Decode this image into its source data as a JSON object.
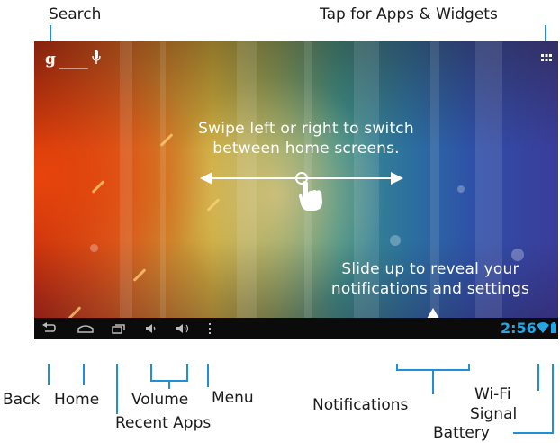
{
  "callouts": {
    "search": "Search",
    "apps_widgets": "Tap for Apps & Widgets",
    "back": "Back",
    "home": "Home",
    "recent_apps": "Recent Apps",
    "volume": "Volume",
    "menu": "Menu",
    "notifications": "Notifications",
    "wifi_signal_line1": "Wi-Fi",
    "wifi_signal_line2": "Signal",
    "battery": "Battery"
  },
  "screen": {
    "swipe_hint_line1": "Swipe left or right to switch",
    "swipe_hint_line2": "between home screens.",
    "slide_hint_line1": "Slide up to reveal your",
    "slide_hint_line2": "notifications and settings",
    "search_glyph": "g",
    "clock": "2:56"
  },
  "icons": {
    "search": "google-g-icon",
    "voice": "microphone-icon",
    "apps": "apps-grid-icon",
    "back": "back-icon",
    "home": "home-icon",
    "recent": "recent-apps-icon",
    "volume_down": "volume-down-icon",
    "volume_up": "volume-up-icon",
    "menu": "menu-icon",
    "wifi": "wifi-icon",
    "battery": "battery-icon",
    "swipe_hand": "swipe-hand-icon"
  },
  "colors": {
    "callout_line": "#1f8fd6",
    "clock": "#23a6e6",
    "navbar": "#0b0b0b"
  }
}
